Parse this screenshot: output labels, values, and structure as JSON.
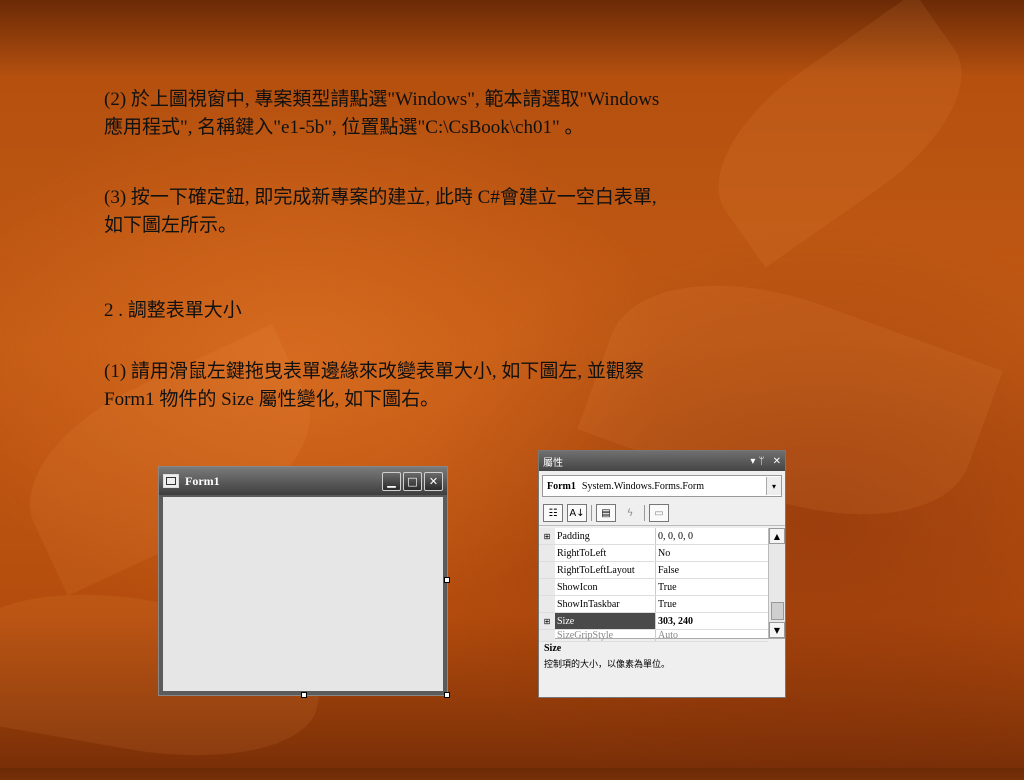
{
  "slide": {
    "para1_line1": "(2) 於上圖視窗中, 專案類型請點選\"Windows\", 範本請選取\"Windows",
    "para1_line2": "應用程式\", 名稱鍵入\"e1-5b\", 位置點選\"C:\\CsBook\\ch01\" 。",
    "para2_line1": "(3) 按一下確定鈕, 即完成新專案的建立, 此時 C#會建立一空白表單,",
    "para2_line2": "如下圖左所示。",
    "heading": "2 . 調整表單大小",
    "para3_line1": "(1) 請用滑鼠左鍵拖曳表單邊緣來改變表單大小, 如下圖左, 並觀察",
    "para3_line2": "Form1 物件的 Size 屬性變化, 如下圖右。"
  },
  "form_window": {
    "title": "Form1",
    "min_glyph": "▁",
    "max_glyph": "□",
    "close_glyph": "✕"
  },
  "properties_window": {
    "title": "屬性",
    "pin_glyph": "▾ ᛘ",
    "close_glyph": "✕",
    "object_name": "Form1",
    "object_type": "System.Windows.Forms.Form",
    "dropdown_glyph": "▾",
    "toolbar": {
      "categorized_glyph": "☷",
      "alphabetical_glyph": "A↓",
      "properties_glyph": "▤",
      "events_glyph": "ϟ",
      "pages_glyph": "▭"
    },
    "rows": [
      {
        "expander": "⊞",
        "name": "Padding",
        "value": "0, 0, 0, 0"
      },
      {
        "expander": "",
        "name": "RightToLeft",
        "value": "No"
      },
      {
        "expander": "",
        "name": "RightToLeftLayout",
        "value": "False"
      },
      {
        "expander": "",
        "name": "ShowIcon",
        "value": "True"
      },
      {
        "expander": "",
        "name": "ShowInTaskbar",
        "value": "True"
      },
      {
        "expander": "⊞",
        "name": "Size",
        "value": "303, 240"
      },
      {
        "expander": "",
        "name": "SizeGripStyle",
        "value": "Auto"
      }
    ],
    "scroll_up": "▲",
    "scroll_down": "▼",
    "description_title": "Size",
    "description_text": "控制項的大小，以像素為單位。"
  }
}
